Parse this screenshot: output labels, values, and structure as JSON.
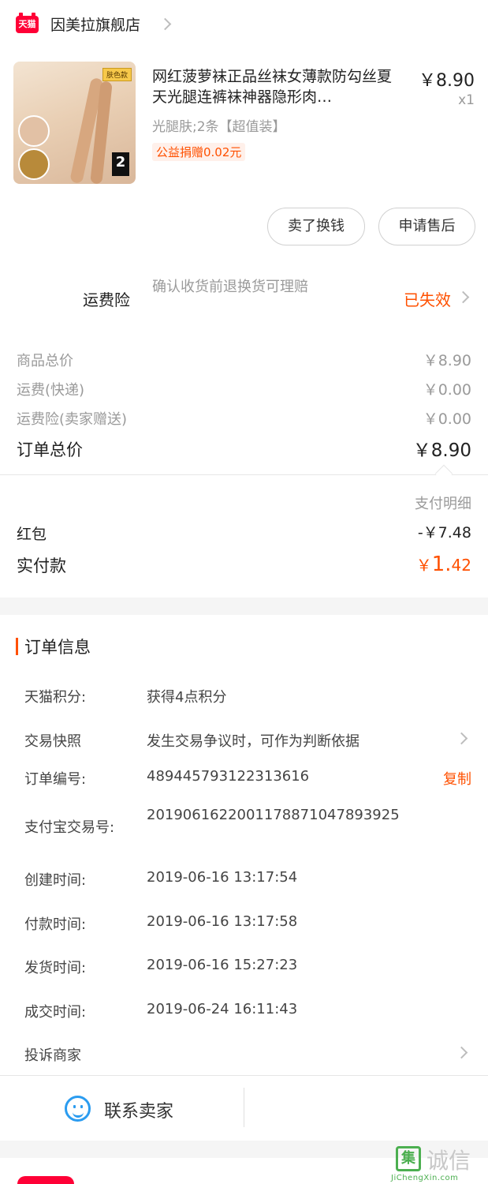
{
  "header": {
    "store_badge": "天猫",
    "store_name": "因美拉旗舰店"
  },
  "product": {
    "image_tag": "肤色款",
    "image_count": "2",
    "title": "网红菠萝袜正品丝袜女薄款防勾丝夏天光腿连裤袜神器隐形肉…",
    "price": "￥8.90",
    "qty": "x1",
    "sku": "光腿肤;2条【超值装】",
    "charity": "公益捐赠0.02元"
  },
  "actions": {
    "exchange": "卖了换钱",
    "after_sale": "申请售后"
  },
  "insurance": {
    "label": "运费险",
    "desc": "确认收货前退换货可理赔",
    "status": "已失效"
  },
  "summary": {
    "rows": [
      {
        "label": "商品总价",
        "value": "￥8.90"
      },
      {
        "label": "运费(快递)",
        "value": "￥0.00"
      },
      {
        "label": "运费险(卖家赠送)",
        "value": "￥0.00"
      }
    ],
    "total_label": "订单总价",
    "total_value": "￥8.90"
  },
  "payment": {
    "detail_label": "支付明细",
    "red_label": "红包",
    "red_value": "-￥7.48",
    "paid_label": "实付款",
    "paid_currency": "￥",
    "paid_int": "1.",
    "paid_dec": "42"
  },
  "order_info": {
    "title": "订单信息",
    "rows": [
      {
        "label": "天猫积分:",
        "value": "获得4点积分"
      },
      {
        "label": "交易快照",
        "value": "发生交易争议时，可作为判断依据"
      },
      {
        "label": "订单编号:",
        "value": "489445793122313616"
      },
      {
        "label": "支付宝交易号:",
        "value": "2019061622001178871047893925"
      },
      {
        "label": "创建时间:",
        "value": "2019-06-16 13:17:54"
      },
      {
        "label": "付款时间:",
        "value": "2019-06-16 13:17:58"
      },
      {
        "label": "发货时间:",
        "value": "2019-06-16 15:27:23"
      },
      {
        "label": "成交时间:",
        "value": "2019-06-24 16:11:43"
      },
      {
        "label": "投诉商家",
        "value": ""
      }
    ],
    "copy_label": "复制"
  },
  "contact": {
    "label": "联系卖家"
  },
  "watermark": {
    "glyph": "集",
    "text": "诚信",
    "url": "JiChengXin.com"
  },
  "colors": {
    "accent": "#ff5000",
    "tmall_red": "#ff0036",
    "contact_blue": "#2b9cf0"
  }
}
